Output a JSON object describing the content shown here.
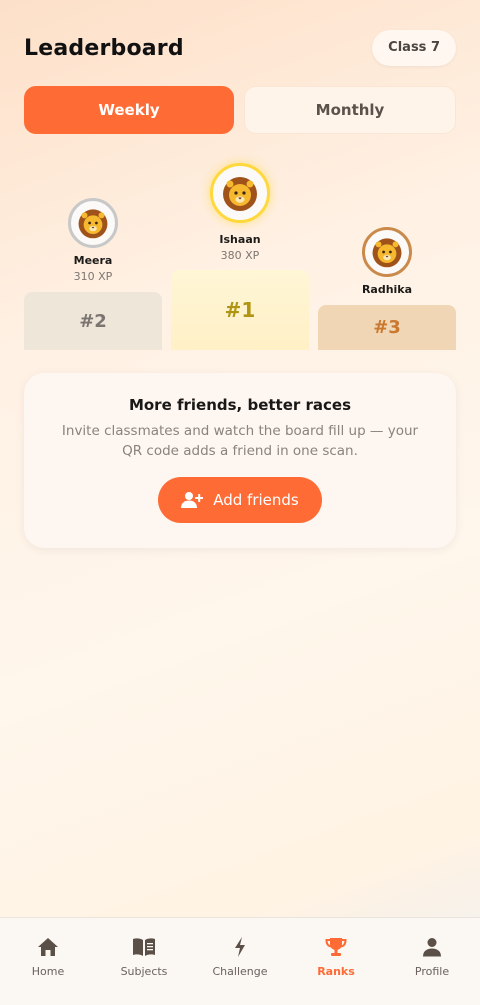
{
  "header": {
    "title": "Leaderboard",
    "class_badge": "Class 7"
  },
  "tabs": [
    {
      "label": "Weekly",
      "active": true
    },
    {
      "label": "Monthly",
      "active": false
    }
  ],
  "podium": [
    {
      "rank": "#2",
      "name": "Meera",
      "xp": "310 XP",
      "avatar_icon": "lion-icon",
      "ring_color": "#c8c8c8",
      "block_color": "#efe6da",
      "rank_color": "#7a7570"
    },
    {
      "rank": "#1",
      "name": "Ishaan",
      "xp": "380 XP",
      "avatar_icon": "lion-icon",
      "ring_color": "#ffd83d",
      "block_color": "#fff1c8",
      "rank_color": "#b09512"
    },
    {
      "rank": "#3",
      "name": "Radhika",
      "xp": "",
      "avatar_icon": "lion-icon",
      "ring_color": "#c98a4b",
      "block_color": "#f0d6b4",
      "rank_color": "#c8782f"
    }
  ],
  "invite": {
    "title": "More friends, better races",
    "description": "Invite classmates and watch the board fill up — your QR code adds a friend in one scan.",
    "button_label": "Add friends",
    "button_icon": "add-person-icon"
  },
  "nav": [
    {
      "label": "Home",
      "icon": "home-icon",
      "active": false
    },
    {
      "label": "Subjects",
      "icon": "book-icon",
      "active": false
    },
    {
      "label": "Challenge",
      "icon": "lightning-icon",
      "active": false
    },
    {
      "label": "Ranks",
      "icon": "trophy-icon",
      "active": true
    },
    {
      "label": "Profile",
      "icon": "person-icon",
      "active": false
    }
  ],
  "colors": {
    "accent": "#ff6b35",
    "text_primary": "#1d1b19",
    "text_muted": "#8a837d"
  }
}
